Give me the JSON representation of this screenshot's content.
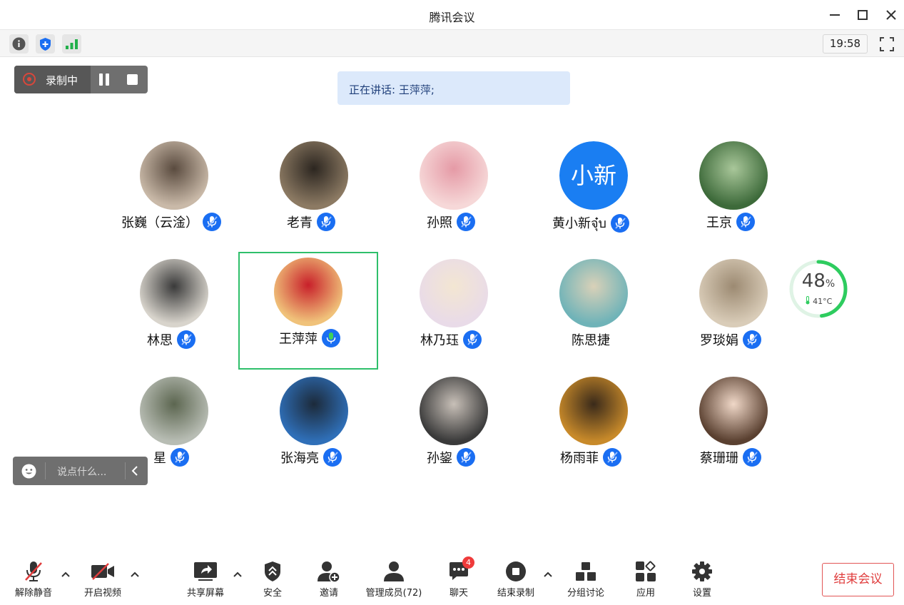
{
  "window": {
    "title": "腾讯会议"
  },
  "infobar": {
    "time": "19:58"
  },
  "recording": {
    "label": "录制中"
  },
  "speaking": {
    "text": "正在讲话: 王萍萍;"
  },
  "participants": [
    {
      "name": "张巍（云淦）",
      "mic": "muted"
    },
    {
      "name": "老青",
      "mic": "muted"
    },
    {
      "name": "孙照",
      "mic": "muted"
    },
    {
      "name": "黄小新จุ๋บ",
      "mic": "muted",
      "avatar_text": "小新"
    },
    {
      "name": "王京",
      "mic": "muted"
    },
    {
      "name": "林思",
      "mic": "muted"
    },
    {
      "name": "王萍萍",
      "mic": "speaking",
      "active": true
    },
    {
      "name": "林乃珏",
      "mic": "muted"
    },
    {
      "name": "陈思捷",
      "mic": "none"
    },
    {
      "name": "罗琰娟",
      "mic": "muted"
    },
    {
      "name": "星",
      "mic": "muted"
    },
    {
      "name": "张海亮",
      "mic": "muted"
    },
    {
      "name": "孙鋆",
      "mic": "muted"
    },
    {
      "name": "杨雨菲",
      "mic": "muted"
    },
    {
      "name": "蔡珊珊",
      "mic": "muted"
    }
  ],
  "performance": {
    "cpu_percent": "48",
    "unit": "%",
    "temp": "41°C",
    "level": 0.48
  },
  "chat_input": {
    "placeholder": "说点什么..."
  },
  "toolbar": {
    "unmute": "解除静音",
    "start_video": "开启视频",
    "share_screen": "共享屏幕",
    "security": "安全",
    "invite": "邀请",
    "manage_members": "管理成员(72)",
    "chat": "聊天",
    "chat_badge": "4",
    "end_recording": "结束录制",
    "breakout": "分组讨论",
    "apps": "应用",
    "settings": "设置",
    "end_meeting": "结束会议"
  },
  "colors": {
    "accent": "#1a6ef2",
    "speaking_green": "#2fbf6b",
    "danger": "#e03c3c"
  }
}
